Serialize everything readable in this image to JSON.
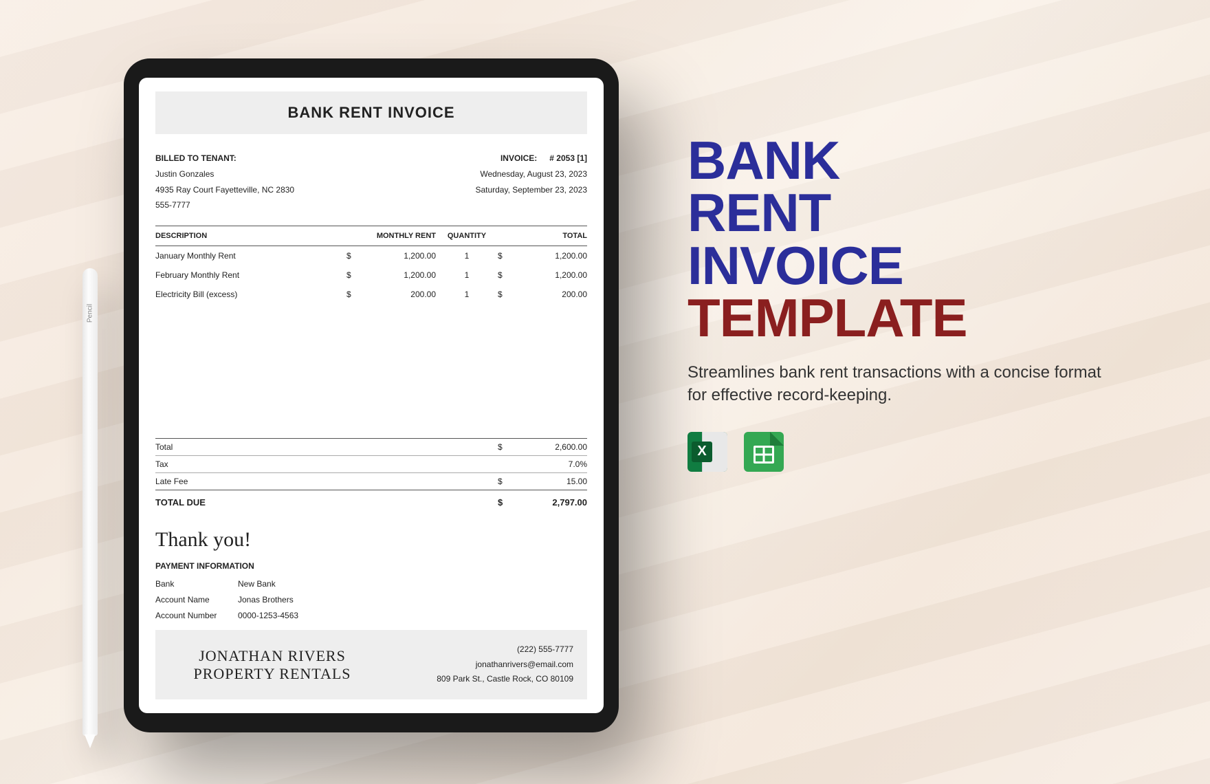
{
  "pencil_label": "Pencil",
  "invoice": {
    "title": "BANK RENT INVOICE",
    "billed_label": "BILLED TO TENANT:",
    "tenant_name": "Justin Gonzales",
    "tenant_addr": "4935 Ray Court Fayetteville, NC 2830",
    "tenant_phone": "555-7777",
    "invoice_label": "INVOICE:",
    "invoice_number": "# 2053 [1]",
    "date1": "Wednesday, August 23, 2023",
    "date2": "Saturday, September 23, 2023",
    "columns": {
      "desc": "DESCRIPTION",
      "rent": "MONTHLY RENT",
      "qty": "QUANTITY",
      "total": "TOTAL"
    },
    "items": [
      {
        "desc": "January Monthly Rent",
        "rent": "1,200.00",
        "qty": "1",
        "total": "1,200.00"
      },
      {
        "desc": "February Monthly Rent",
        "rent": "1,200.00",
        "qty": "1",
        "total": "1,200.00"
      },
      {
        "desc": "Electricity Bill (excess)",
        "rent": "200.00",
        "qty": "1",
        "total": "200.00"
      }
    ],
    "currency": "$",
    "totals": {
      "total_label": "Total",
      "total_value": "2,600.00",
      "tax_label": "Tax",
      "tax_value": "7.0%",
      "late_label": "Late Fee",
      "late_value": "15.00",
      "due_label": "TOTAL DUE",
      "due_value": "2,797.00"
    },
    "thanks": "Thank you!",
    "payment": {
      "header": "PAYMENT INFORMATION",
      "rows": [
        {
          "k": "Bank",
          "v": "New Bank"
        },
        {
          "k": "Account Name",
          "v": "Jonas Brothers"
        },
        {
          "k": "Account Number",
          "v": "0000-1253-4563"
        }
      ]
    },
    "footer": {
      "company": "JONATHAN RIVERS PROPERTY RENTALS",
      "phone": "(222) 555-7777",
      "email": "jonathanrivers@email.com",
      "addr": "809 Park St., Castle Rock, CO 80109"
    }
  },
  "marketing": {
    "line1": "BANK",
    "line2": "RENT",
    "line3": "INVOICE",
    "line4": "TEMPLATE",
    "subtitle": "Streamlines bank rent transactions with a concise format for effective record-keeping.",
    "excel_glyph": "X"
  }
}
